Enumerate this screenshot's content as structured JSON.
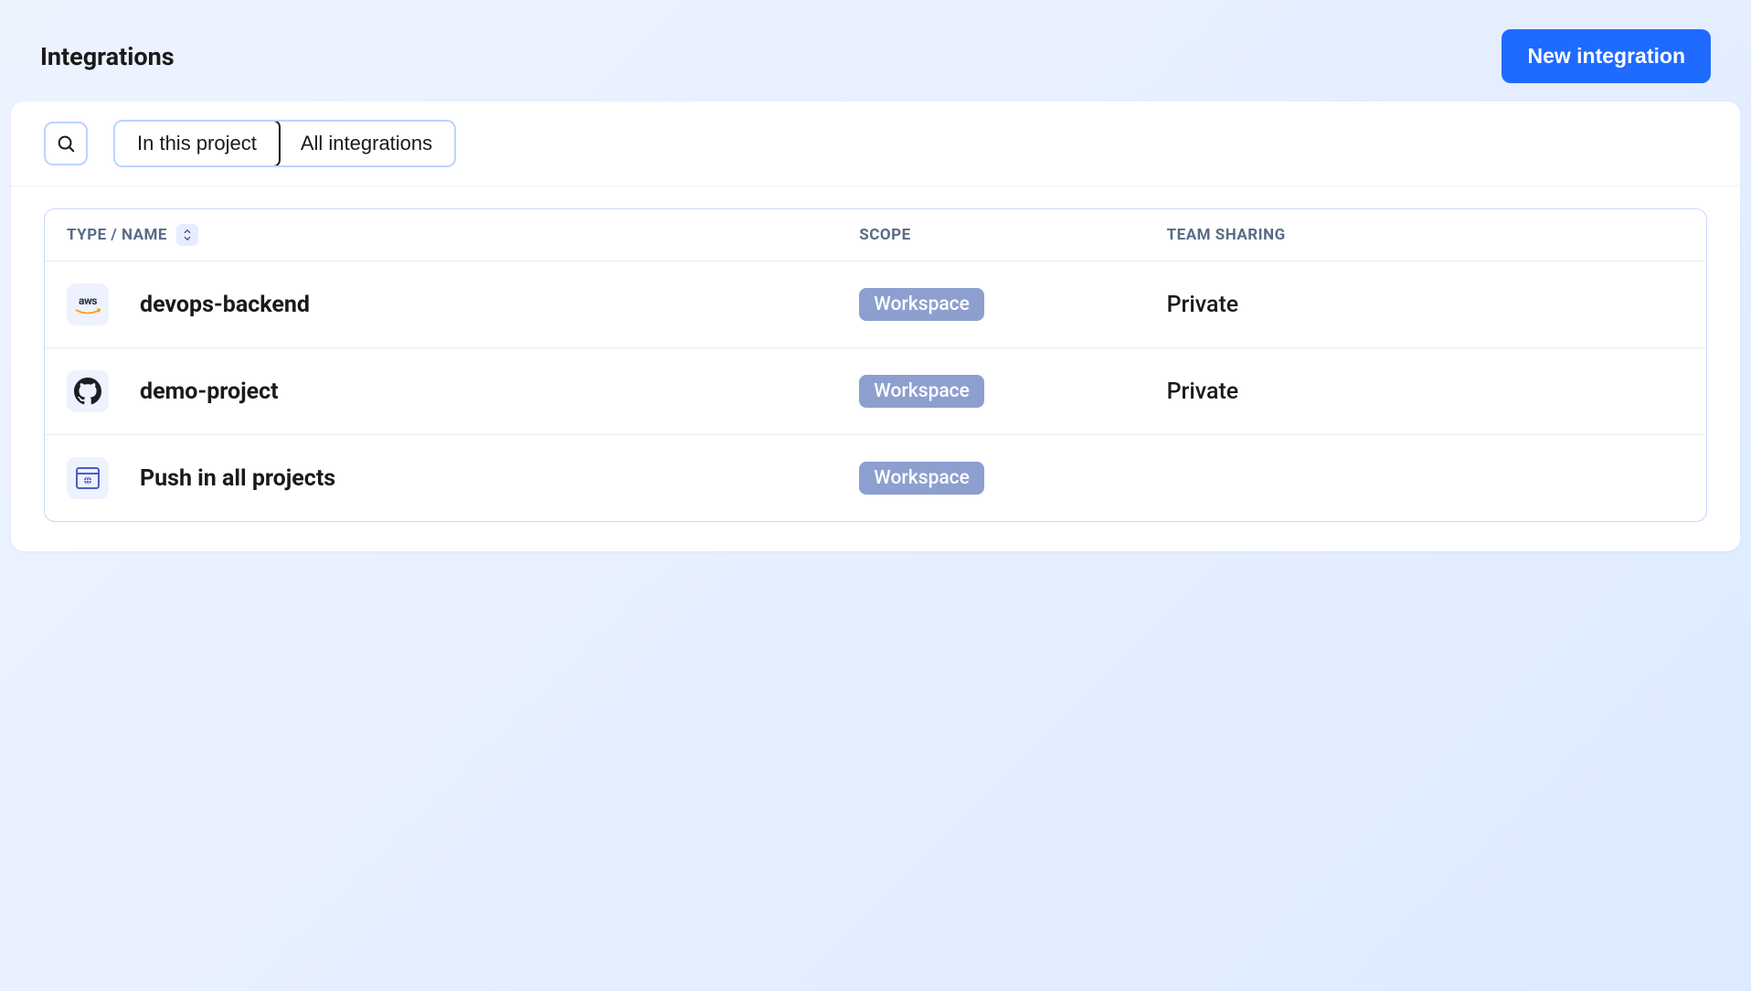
{
  "header": {
    "title": "Integrations",
    "new_button": "New integration"
  },
  "toolbar": {
    "tabs": [
      {
        "label": "In this project",
        "active": true
      },
      {
        "label": "All integrations",
        "active": false
      }
    ]
  },
  "table": {
    "headers": {
      "type_name": "TYPE / NAME",
      "scope": "SCOPE",
      "team_sharing": "TEAM SHARING"
    },
    "rows": [
      {
        "icon": "aws",
        "name": "devops-backend",
        "scope": "Workspace",
        "team_sharing": "Private"
      },
      {
        "icon": "github",
        "name": "demo-project",
        "scope": "Workspace",
        "team_sharing": "Private"
      },
      {
        "icon": "browser",
        "name": "Push in all projects",
        "scope": "Workspace",
        "team_sharing": ""
      }
    ]
  }
}
